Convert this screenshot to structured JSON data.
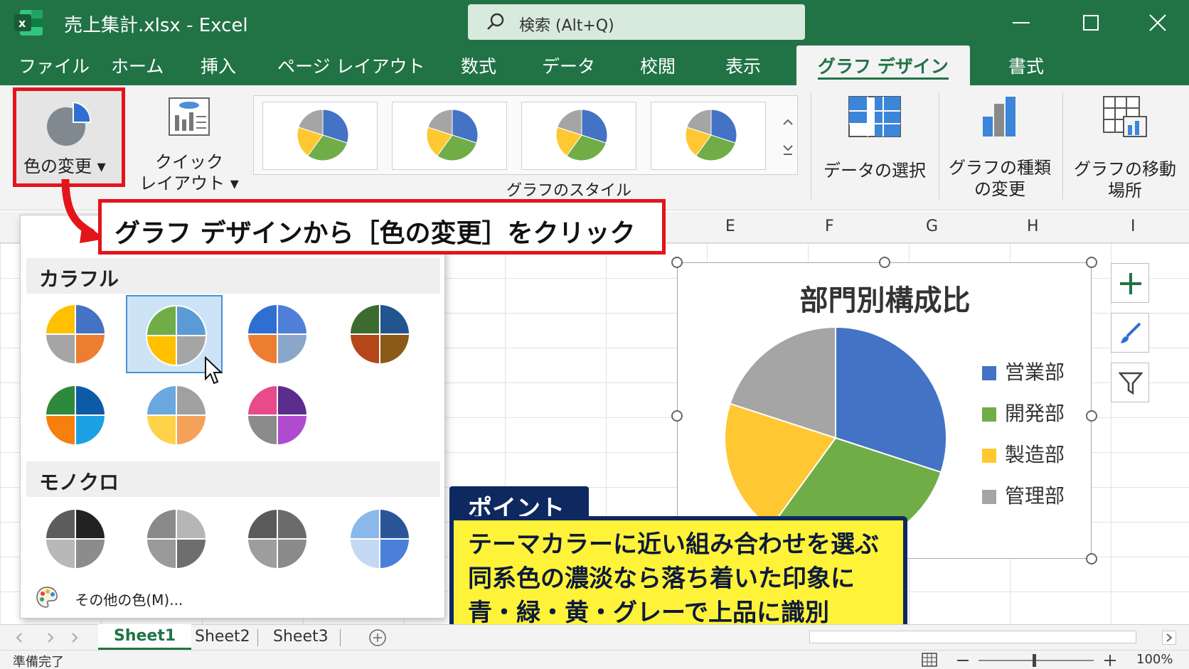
{
  "titlebar": {
    "title": "売上集計.xlsx  -  Excel",
    "search_placeholder": "検索 (Alt+Q)",
    "app_color": "#217346"
  },
  "menu": {
    "tabs": [
      "ファイル",
      "ホーム",
      "挿入",
      "ページ レイアウト",
      "数式",
      "データ",
      "校閲",
      "表示",
      "グラフ デザイン",
      "書式"
    ],
    "active_tab": "グラフ デザイン"
  },
  "ribbon": {
    "change_colors": "色の変更 ▾",
    "quick_layout_line1": "クイック",
    "quick_layout_line2": "レイアウト ▾",
    "chart_styles_caption": "グラフのスタイル",
    "select_data": "データの選択",
    "change_chart_type_line1": "グラフの種類",
    "change_chart_type_line2": "の変更",
    "move_chart_line1": "グラフの移動",
    "move_chart_line2": "場所"
  },
  "columns": [
    "E",
    "F",
    "G",
    "H",
    "I"
  ],
  "callout": "グラフ デザインから［色の変更］をクリック",
  "dropdown": {
    "colorful_heading": "カラフル",
    "monochrome_heading": "モノクロ",
    "more_colors": "その他の色(M)...",
    "colorful_palettes": [
      [
        "#4472c4",
        "#ed7d31",
        "#a5a5a5",
        "#ffc000"
      ],
      [
        "#5b9bd5",
        "#a5a5a5",
        "#ffc000",
        "#70ad47"
      ],
      [
        "#4f7fd6",
        "#8aa6c8",
        "#ed7d31",
        "#2f6fd1"
      ],
      [
        "#22558f",
        "#8a5a16",
        "#b4461a",
        "#3c6b2f"
      ],
      [
        "#0d5aa7",
        "#1ba1e2",
        "#f77f0e",
        "#2e8a3b"
      ],
      [
        "#a0a0a0",
        "#f4a25a",
        "#ffd24a",
        "#6aa8e0"
      ],
      [
        "#5b2d8e",
        "#b04bd0",
        "#8b8b8b",
        "#e84a8a"
      ]
    ],
    "mono_palettes": [
      [
        "#222222",
        "#8c8c8c",
        "#b8b8b8",
        "#5c5c5c"
      ],
      [
        "#b5b5b5",
        "#6e6e6e",
        "#9a9a9a",
        "#8a8a8a"
      ],
      [
        "#6b6b6b",
        "#8a8a8a",
        "#9d9d9d",
        "#5a5a5a"
      ],
      [
        "#2b5597",
        "#4a80d9",
        "#c3d8f3",
        "#8ab8ea"
      ]
    ]
  },
  "chart_data": {
    "type": "pie",
    "title": "部門別構成比",
    "categories": [
      "営業部",
      "開発部",
      "製造部",
      "管理部"
    ],
    "values": [
      30,
      30,
      20,
      20
    ],
    "colors": [
      "#4472c4",
      "#70ad47",
      "#ffc832",
      "#a5a5a5"
    ],
    "legend_position": "right"
  },
  "point": {
    "tag": "ポイント",
    "line1": "テーマカラーに近い組み合わせを選ぶ",
    "line2": "同系色の濃淡なら落ち着いた印象に",
    "line3": "青・緑・黄・グレーで上品に識別"
  },
  "sheets": {
    "tab1": "Sheet1",
    "tab2": "Sheet2",
    "tab3": "Sheet3",
    "active": "Sheet1"
  },
  "status": {
    "ready": "準備完了",
    "zoom": "100%"
  }
}
